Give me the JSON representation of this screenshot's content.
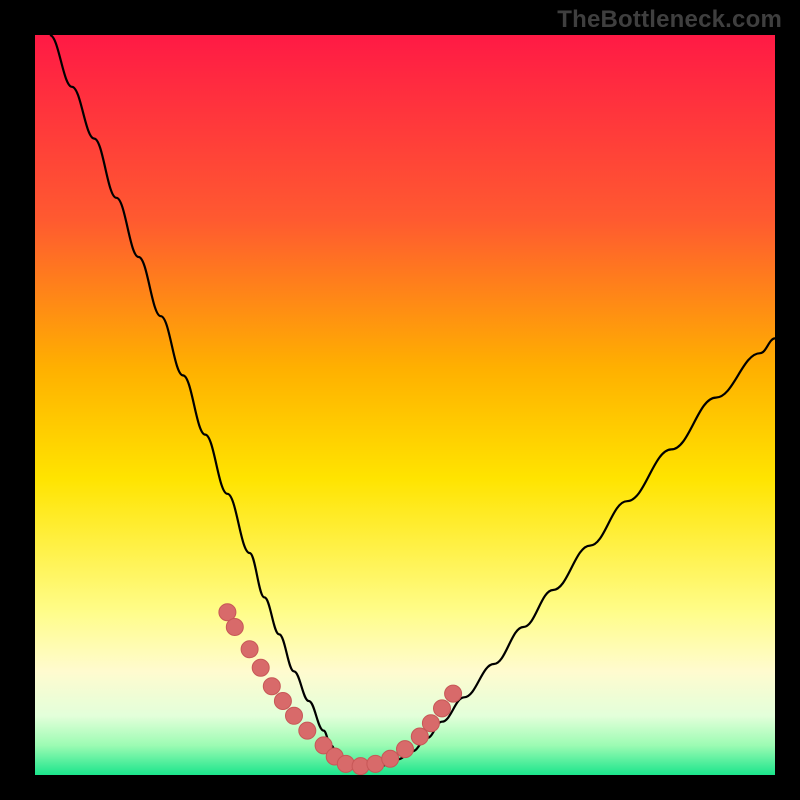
{
  "watermark": "TheBottleneck.com",
  "colors": {
    "frame": "#000000",
    "curve": "#000000",
    "marker_fill": "#d86a6a",
    "marker_stroke": "#c75757",
    "green_band": "#00f38a",
    "gradient_stops": [
      {
        "offset": 0,
        "color": "#ff1a45"
      },
      {
        "offset": 0.25,
        "color": "#ff5a30"
      },
      {
        "offset": 0.45,
        "color": "#ffb000"
      },
      {
        "offset": 0.6,
        "color": "#ffe400"
      },
      {
        "offset": 0.78,
        "color": "#fffd8a"
      },
      {
        "offset": 0.86,
        "color": "#fffbcf"
      },
      {
        "offset": 0.92,
        "color": "#e3ffda"
      },
      {
        "offset": 0.96,
        "color": "#9cfbb3"
      },
      {
        "offset": 1.0,
        "color": "#1be58c"
      }
    ]
  },
  "chart_data": {
    "type": "line",
    "title": "",
    "xlabel": "",
    "ylabel": "",
    "xlim": [
      0,
      100
    ],
    "ylim": [
      0,
      100
    ],
    "series": [
      {
        "name": "bottleneck-curve",
        "x": [
          2,
          5,
          8,
          11,
          14,
          17,
          20,
          23,
          26,
          29,
          31,
          33,
          35,
          37,
          39,
          40,
          41,
          42,
          43.5,
          45,
          47,
          49,
          51,
          53,
          55,
          58,
          62,
          66,
          70,
          75,
          80,
          86,
          92,
          98,
          100
        ],
        "y": [
          100,
          93,
          86,
          78,
          70,
          62,
          54,
          46,
          38,
          30,
          24,
          19,
          14,
          10,
          6,
          4,
          2.5,
          1.5,
          1,
          1,
          1.3,
          2.1,
          3.2,
          5,
          7.2,
          10.5,
          15,
          20,
          25,
          31,
          37,
          44,
          51,
          57,
          59
        ]
      }
    ],
    "markers": {
      "name": "highlighted-points",
      "x": [
        26,
        27,
        29,
        30.5,
        32,
        33.5,
        35,
        36.8,
        39,
        40.5,
        42,
        44,
        46,
        48,
        50,
        52,
        53.5,
        55,
        56.5
      ],
      "y": [
        22,
        20,
        17,
        14.5,
        12,
        10,
        8,
        6,
        4,
        2.5,
        1.5,
        1.2,
        1.5,
        2.2,
        3.5,
        5.2,
        7,
        9,
        11
      ]
    }
  }
}
